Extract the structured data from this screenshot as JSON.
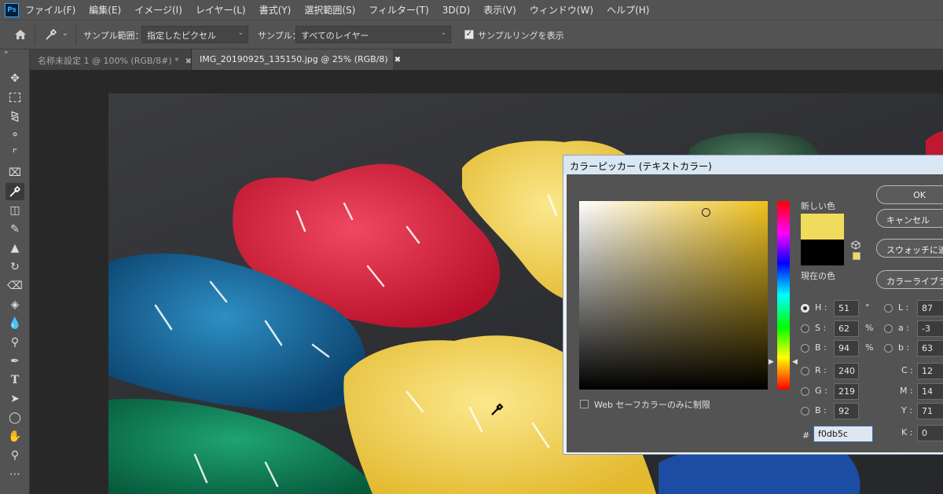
{
  "app": {
    "logo": "Ps"
  },
  "menu": [
    "ファイル(F)",
    "編集(E)",
    "イメージ(I)",
    "レイヤー(L)",
    "書式(Y)",
    "選択範囲(S)",
    "フィルター(T)",
    "3D(D)",
    "表示(V)",
    "ウィンドウ(W)",
    "ヘルプ(H)"
  ],
  "options": {
    "sample_size_label": "サンプル範囲：",
    "sample_size_value": "指定したピクセル",
    "sample_label": "サンプル：",
    "sample_value": "すべてのレイヤー",
    "show_ring_label": "サンプルリングを表示",
    "show_ring_checked": true
  },
  "tabs": [
    {
      "label": "名称未設定 1 @ 100% (RGB/8#) *",
      "active": false
    },
    {
      "label": "IMG_20190925_135150.jpg @ 25% (RGB/8)",
      "active": true
    }
  ],
  "tools": [
    "move-icon",
    "marquee-icon",
    "lasso-icon",
    "quick-select-icon",
    "crop-icon",
    "frame-icon",
    "eyedropper-icon",
    "healing-icon",
    "brush-icon",
    "stamp-icon",
    "history-brush-icon",
    "eraser-icon",
    "paint-bucket-icon",
    "blur-icon",
    "dodge-icon",
    "pen-icon",
    "type-icon",
    "path-select-icon",
    "ellipse-icon",
    "hand-icon",
    "zoom-icon",
    "more-icon"
  ],
  "color_picker": {
    "title": "カラーピッカー (テキストカラー)",
    "new_label": "新しい色",
    "current_label": "現在の色",
    "new_color": "#f0db5c",
    "current_color": "#000000",
    "buttons": {
      "ok": "OK",
      "cancel": "キャンセル",
      "add_swatch": "スウォッチに追加",
      "libraries": "カラーライブラリ"
    },
    "hsb": {
      "h_label": "H :",
      "h": "51",
      "h_unit": "°",
      "s_label": "S :",
      "s": "62",
      "s_unit": "%",
      "b_label": "B :",
      "b": "94",
      "b_unit": "%"
    },
    "rgb": {
      "r_label": "R :",
      "r": "240",
      "g_label": "G :",
      "g": "219",
      "b_label": "B :",
      "b": "92"
    },
    "lab": {
      "l_label": "L :",
      "l": "87",
      "a_label": "a :",
      "a": "-3",
      "b_label": "b :",
      "b": "63"
    },
    "cmyk": {
      "c_label": "C :",
      "c": "12",
      "m_label": "M :",
      "m": "14",
      "y_label": "Y :",
      "y": "71",
      "k_label": "K :",
      "k": "0"
    },
    "hex_label": "#",
    "hex": "f0db5c",
    "web_only_label": "Web セーフカラーのみに制限",
    "selected_mode": "H"
  }
}
